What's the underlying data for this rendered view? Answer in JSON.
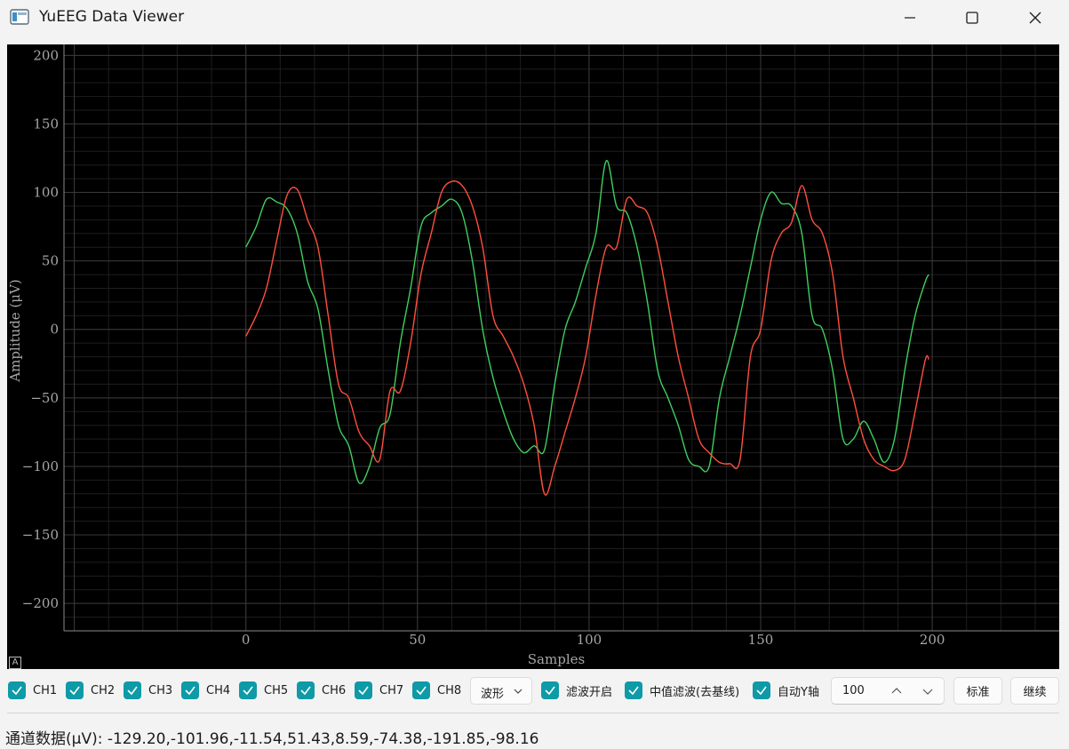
{
  "window": {
    "title": "YuEEG Data Viewer"
  },
  "plot": {
    "auto_button_label": "A"
  },
  "chart_data": {
    "type": "line",
    "xlabel": "Samples",
    "ylabel": "Amplitude (μV)",
    "xlim": [
      -53,
      237
    ],
    "ylim": [
      -220,
      208
    ],
    "x_ticks": [
      0,
      50,
      100,
      150,
      200
    ],
    "y_ticks": [
      200,
      150,
      100,
      50,
      0,
      -50,
      -100,
      -150,
      -200
    ],
    "grid": true,
    "series": [
      {
        "color": "#3fcf5f",
        "x": [
          0,
          3,
          6,
          9,
          12,
          15,
          18,
          21,
          24,
          27,
          30,
          33,
          36,
          39,
          42,
          45,
          48,
          51,
          54,
          57,
          60,
          63,
          66,
          69,
          72,
          75,
          78,
          81,
          84,
          87,
          90,
          93,
          96,
          99,
          102,
          105,
          108,
          111,
          114,
          117,
          120,
          123,
          126,
          129,
          132,
          135,
          138,
          141,
          144,
          147,
          150,
          153,
          156,
          159,
          162,
          165,
          168,
          171,
          174,
          177,
          180,
          183,
          186,
          189,
          192,
          195,
          198,
          199
        ],
        "values": [
          60,
          75,
          95,
          93,
          88,
          70,
          35,
          15,
          -30,
          -70,
          -85,
          -112,
          -100,
          -72,
          -62,
          -10,
          30,
          75,
          85,
          90,
          95,
          85,
          50,
          0,
          -35,
          -60,
          -80,
          -90,
          -85,
          -88,
          -40,
          0,
          20,
          45,
          70,
          123,
          90,
          85,
          60,
          20,
          -30,
          -50,
          -70,
          -95,
          -100,
          -100,
          -50,
          -20,
          10,
          45,
          80,
          100,
          92,
          90,
          70,
          10,
          0,
          -30,
          -80,
          -80,
          -67,
          -80,
          -97,
          -80,
          -30,
          10,
          35,
          40
        ]
      },
      {
        "color": "#ff4f3f",
        "x": [
          0,
          3,
          6,
          9,
          12,
          15,
          18,
          21,
          24,
          27,
          30,
          33,
          36,
          39,
          42,
          45,
          48,
          51,
          54,
          57,
          60,
          63,
          66,
          69,
          72,
          75,
          78,
          81,
          84,
          87,
          90,
          93,
          96,
          99,
          102,
          105,
          108,
          111,
          114,
          117,
          120,
          123,
          126,
          129,
          132,
          135,
          138,
          141,
          144,
          147,
          150,
          153,
          156,
          159,
          162,
          165,
          168,
          171,
          174,
          177,
          180,
          183,
          186,
          189,
          192,
          195,
          198,
          199
        ],
        "values": [
          -5,
          10,
          30,
          65,
          98,
          102,
          80,
          60,
          10,
          -40,
          -50,
          -75,
          -85,
          -95,
          -45,
          -45,
          -10,
          40,
          70,
          100,
          108,
          105,
          90,
          60,
          10,
          -5,
          -20,
          -40,
          -70,
          -120,
          -100,
          -75,
          -50,
          -20,
          25,
          60,
          60,
          95,
          90,
          85,
          60,
          20,
          -20,
          -50,
          -80,
          -90,
          -97,
          -98,
          -95,
          -20,
          0,
          50,
          70,
          78,
          105,
          80,
          70,
          40,
          -20,
          -50,
          -80,
          -95,
          -100,
          -103,
          -95,
          -60,
          -22,
          -22
        ]
      }
    ]
  },
  "controls": {
    "channels": [
      {
        "label": "CH1",
        "checked": true
      },
      {
        "label": "CH2",
        "checked": true
      },
      {
        "label": "CH3",
        "checked": true
      },
      {
        "label": "CH4",
        "checked": true
      },
      {
        "label": "CH5",
        "checked": true
      },
      {
        "label": "CH6",
        "checked": true
      },
      {
        "label": "CH7",
        "checked": true
      },
      {
        "label": "CH8",
        "checked": true
      }
    ],
    "mode_select": "波形",
    "filter_label": "滤波开启",
    "median_label": "中值滤波(去基线)",
    "autoy_label": "自动Y轴",
    "spin_value": "100",
    "standard_button": "标准",
    "continue_button": "继续"
  },
  "status": {
    "text": "通道数据(μV): -129.20,-101.96,-11.54,51.43,8.59,-74.38,-191.85,-98.16"
  },
  "colors": {
    "accent": "#0e9aa7",
    "plot_bg": "#000000"
  }
}
